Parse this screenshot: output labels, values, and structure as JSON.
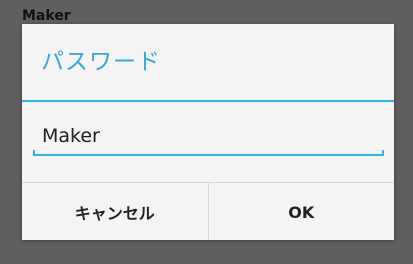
{
  "background": {
    "title": "Maker"
  },
  "dialog": {
    "title": "パスワード",
    "input": {
      "value": "Maker",
      "placeholder": ""
    },
    "buttons": {
      "cancel_label": "キャンセル",
      "ok_label": "OK"
    }
  },
  "colors": {
    "accent": "#35b4e8",
    "title_text": "#39a8dc",
    "dialog_background": "#f4f4f4",
    "screen_background": "#5f5f5f"
  }
}
